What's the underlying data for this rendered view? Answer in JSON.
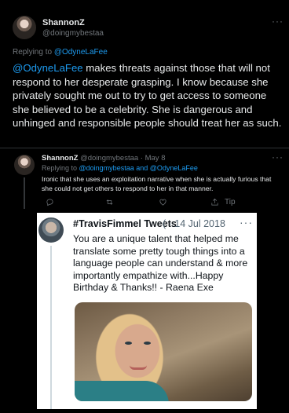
{
  "main_tweet": {
    "display_name": "ShannonZ",
    "handle": "@doingmybestaa",
    "replying_label": "Replying to ",
    "replying_to": "@OdyneLaFee",
    "mention": "@OdyneLaFee",
    "text": " makes threats against those that will not respond to her desperate grasping. I know because she privately sought me out to try to get access to someone she believed to be a celebrity.  She is dangerous and unhinged and responsible people should treat her as such."
  },
  "reply_tweet": {
    "display_name": "ShannonZ",
    "meta": "@doingmybestaa · May 8",
    "replying_label": "Replying to ",
    "replying_to": "@doingmybestaa and @OdyneLaFee",
    "text": "Ironic that she uses an exploitation narrative when she is actually furious that she could not get others to respond to her in that manner.",
    "tip_label": "Tip"
  },
  "embedded_tweet": {
    "display_name": "#TravisFimmel Tweets",
    "date": "( · 14 Jul 2018",
    "text": "You are a unique talent that helped me translate some pretty tough things into a language people can understand & more importantly empathize with...Happy Birthday & Thanks!! - Raena Exe"
  },
  "icons": {
    "more": "more-dots-icon",
    "reply": "reply-icon",
    "retweet": "retweet-icon",
    "like": "heart-icon",
    "share": "share-icon"
  },
  "colors": {
    "accent": "#1d9bf0",
    "background": "#000000",
    "secondary_text": "#71767b"
  }
}
